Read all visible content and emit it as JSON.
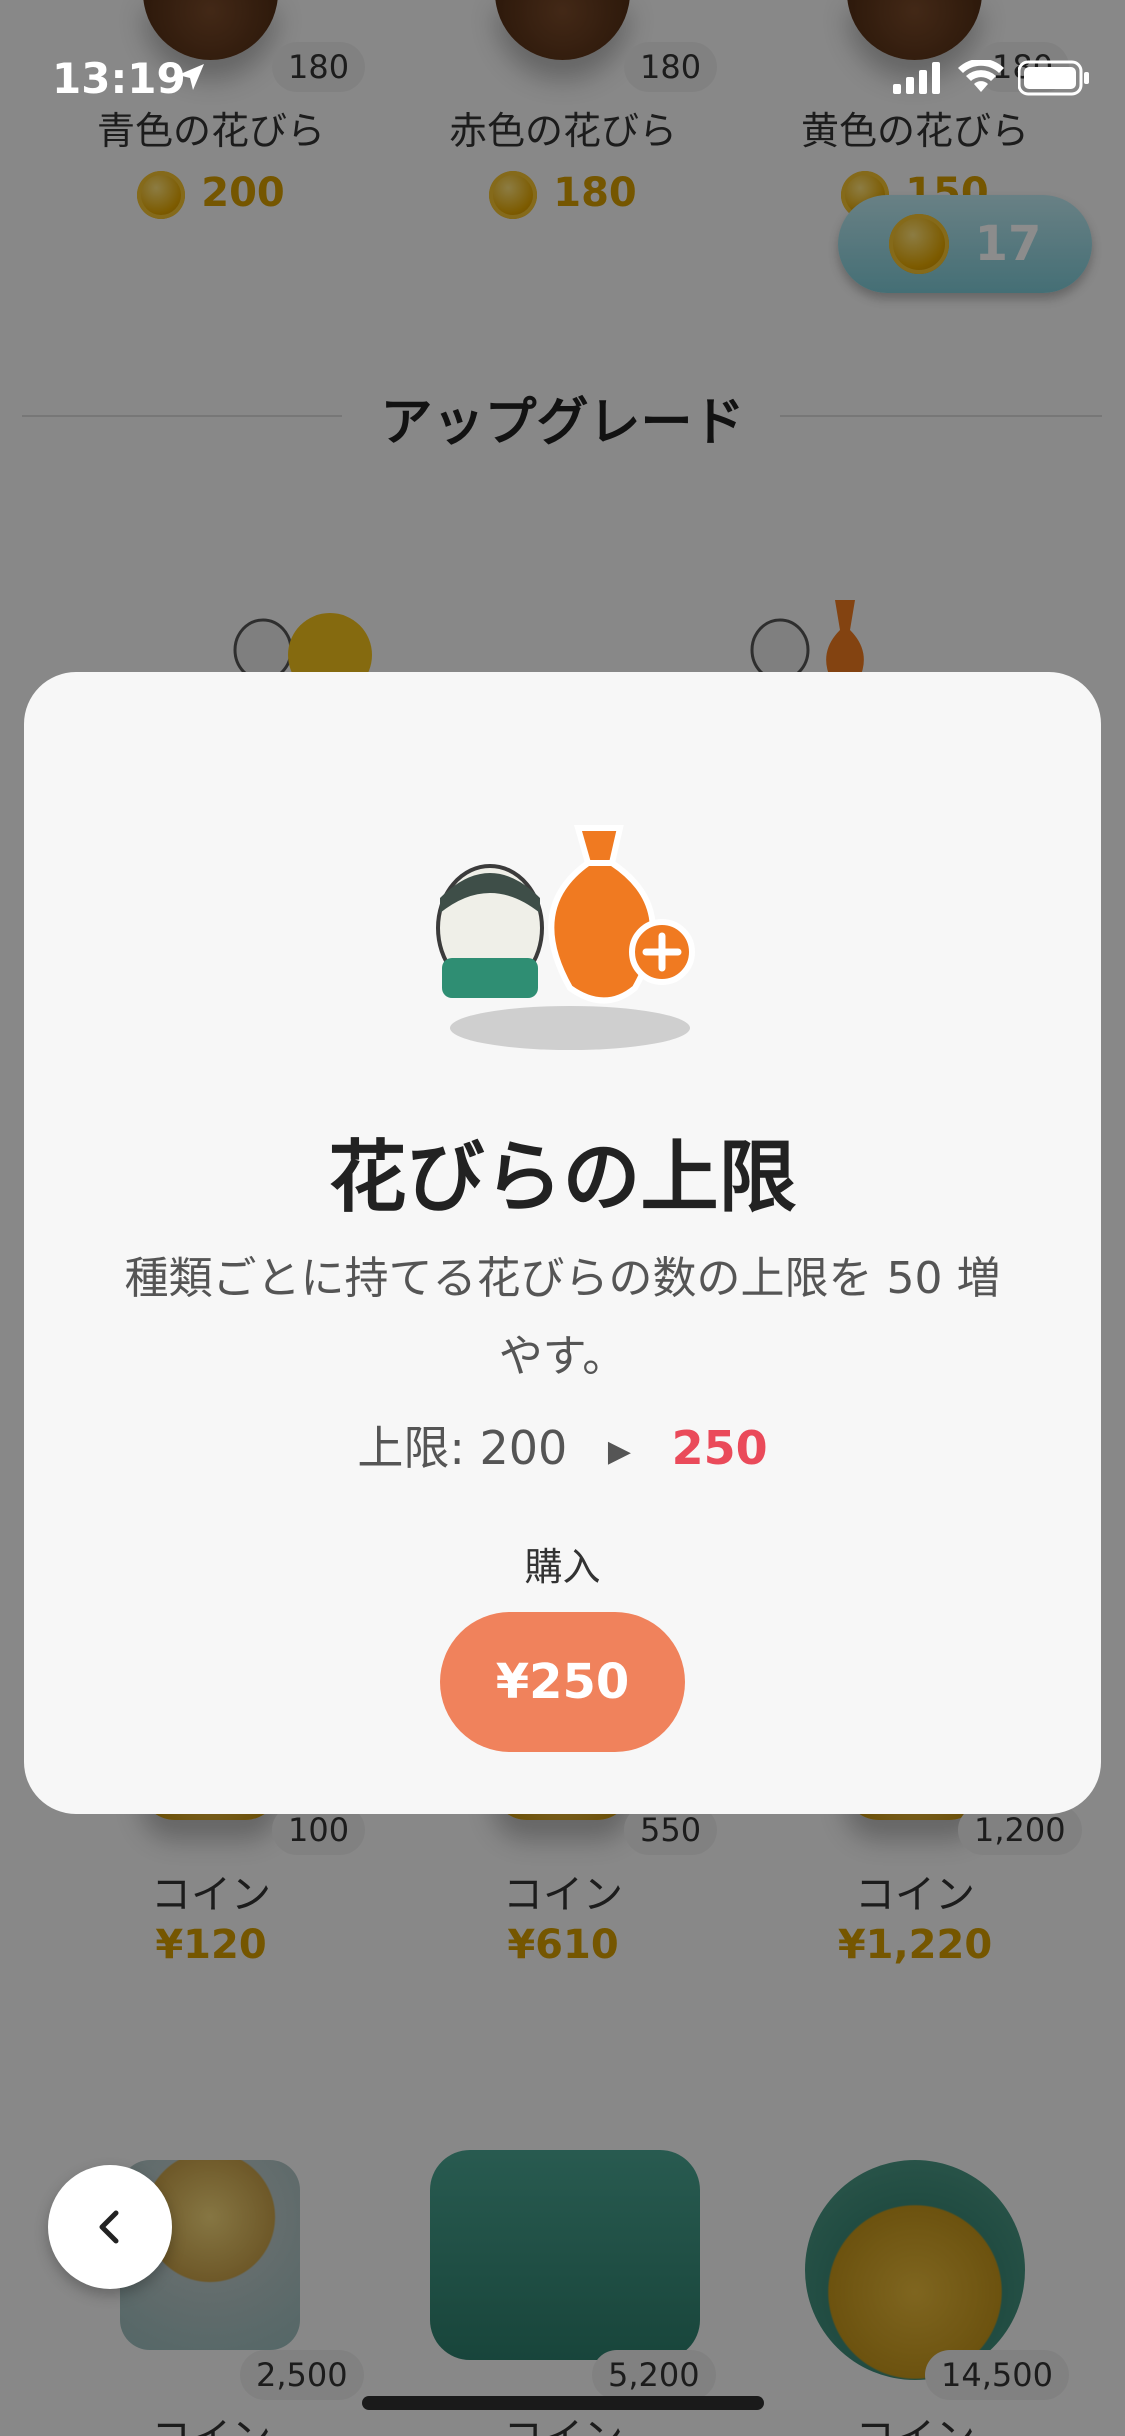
{
  "status_bar": {
    "time": "13:19"
  },
  "shop": {
    "petal_items": [
      {
        "name": "青色の花びら",
        "count": "180",
        "price": "200"
      },
      {
        "name": "赤色の花びら",
        "count": "180",
        "price": "180"
      },
      {
        "name": "黄色の花びら",
        "count": "180",
        "price": "150"
      }
    ],
    "coin_balance": "17",
    "section_title": "アップグレード",
    "coin_items": [
      {
        "label": "コイン",
        "count": "100",
        "price": "¥120"
      },
      {
        "label": "コイン",
        "count": "550",
        "price": "¥610"
      },
      {
        "label": "コイン",
        "count": "1,200",
        "price": "¥1,220"
      }
    ],
    "coin_items_row2": [
      {
        "label": "コイン",
        "count": "2,500"
      },
      {
        "label": "コイン",
        "count": "5,200"
      },
      {
        "label": "コイン",
        "count": "14,500"
      }
    ]
  },
  "modal": {
    "title": "花びらの上限",
    "description": "種類ごとに持てる花びらの数の上限を 50 増やす。",
    "limit_label": "上限: 200",
    "limit_new": "250",
    "buy_label": "購入",
    "buy_price": "¥250"
  },
  "colors": {
    "accent": "#f0825c",
    "highlight": "#ea4a5a",
    "coin_text": "#d59d00"
  }
}
